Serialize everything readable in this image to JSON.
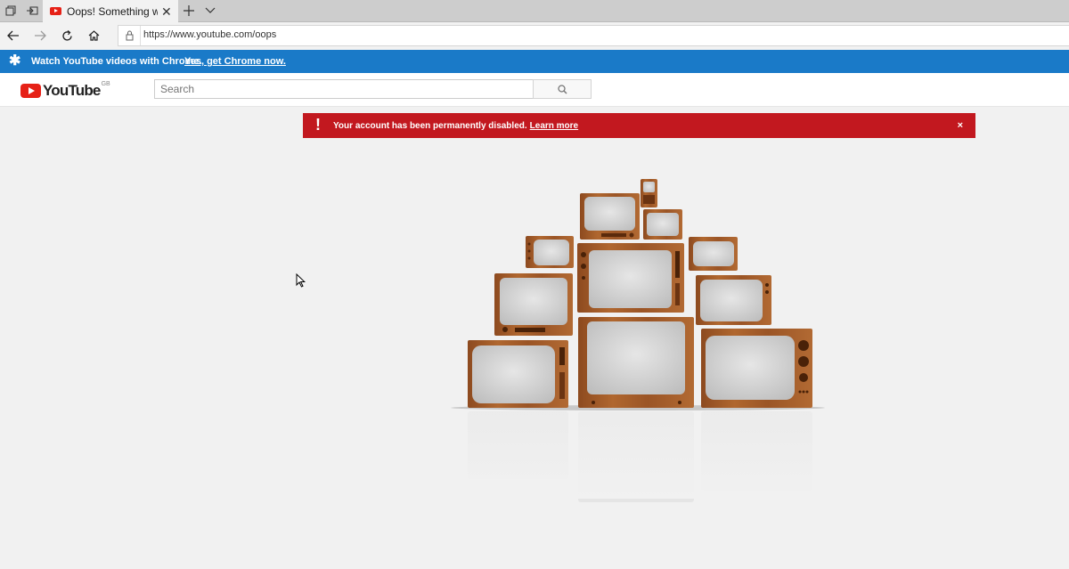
{
  "browser": {
    "tab_title": "Oops! Something went",
    "url": "https://www.youtube.com/oops"
  },
  "promo": {
    "message": "Watch YouTube videos with Chrome.",
    "link": "Yes, get Chrome now."
  },
  "masthead": {
    "logo_text": "YouTube",
    "region": "GB",
    "search_placeholder": "Search"
  },
  "alert": {
    "message": "Your account has been permanently disabled.",
    "link": "Learn more",
    "close": "×"
  },
  "colors": {
    "brand_red": "#e62117",
    "alert_red": "#c2181f",
    "promo_blue": "#1a7ac8",
    "wood": "#a05a2c"
  }
}
